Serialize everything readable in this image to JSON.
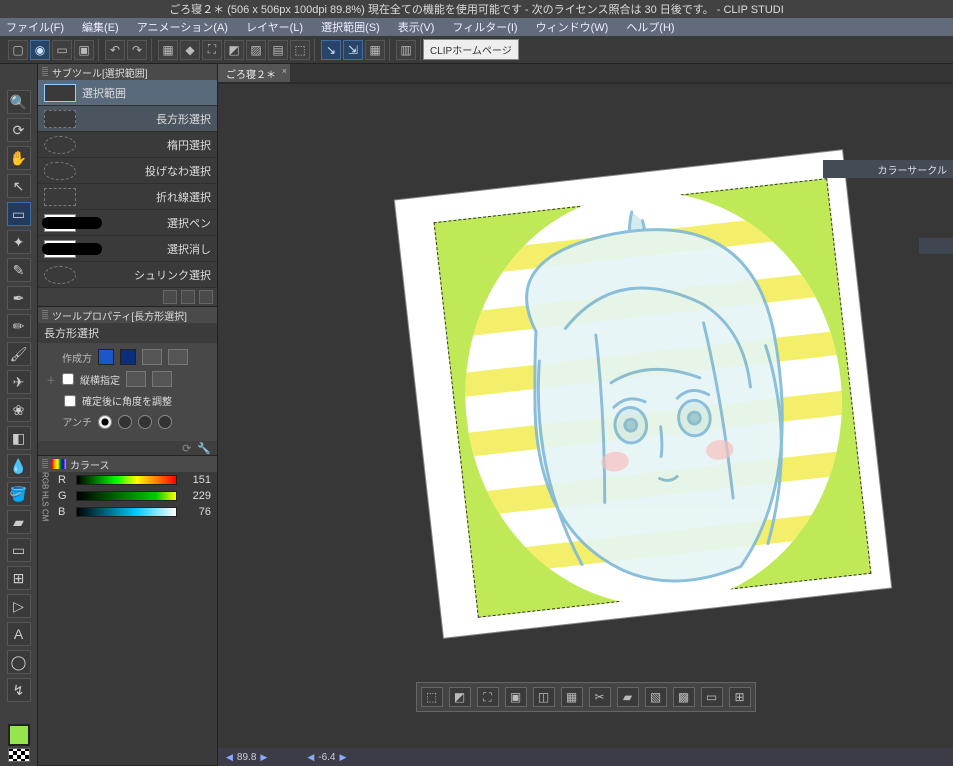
{
  "titlebar": "ごろ寝２＊ (506 x 506px 100dpi 89.8%)  現在全ての機能を使用可能です - 次のライセンス照合は 30 日後です。 - CLIP STUDI",
  "menu": {
    "file": "ファイル(F)",
    "edit": "編集(E)",
    "animation": "アニメーション(A)",
    "layer": "レイヤー(L)",
    "selection": "選択範囲(S)",
    "view": "表示(V)",
    "filter": "フィルター(I)",
    "window": "ウィンドウ(W)",
    "help": "ヘルプ(H)"
  },
  "homepage_btn": "CLIPホームページ",
  "doc_tab": "ごろ寝２＊",
  "subtool": {
    "header": "サブツール[選択範囲]",
    "group": "選択範囲",
    "items": {
      "rect": "長方形選択",
      "ellipse": "楕円選択",
      "lasso": "投げなわ選択",
      "polyline": "折れ線選択",
      "pen": "選択ペン",
      "erase": "選択消し",
      "shrink": "シュリンク選択"
    }
  },
  "toolprop": {
    "header": "ツールプロパティ[長方形選択]",
    "title": "長方形選択",
    "create_lbl": "作成方",
    "aspect_lbl": "縦横指定",
    "angle_lbl": "確定後に角度を調整",
    "antialias_lbl": "アンチ"
  },
  "colorpanel": {
    "header": "カラース",
    "r_lbl": "R",
    "r_val": "151",
    "g_lbl": "G",
    "g_val": "229",
    "b_lbl": "B",
    "b_val": "76",
    "mode1": "RGB",
    "mode2": "HLS",
    "mode3": "CM"
  },
  "right_tab": "カラーサークル",
  "status": {
    "zoom": "89.8",
    "rotation": "-6.4"
  }
}
